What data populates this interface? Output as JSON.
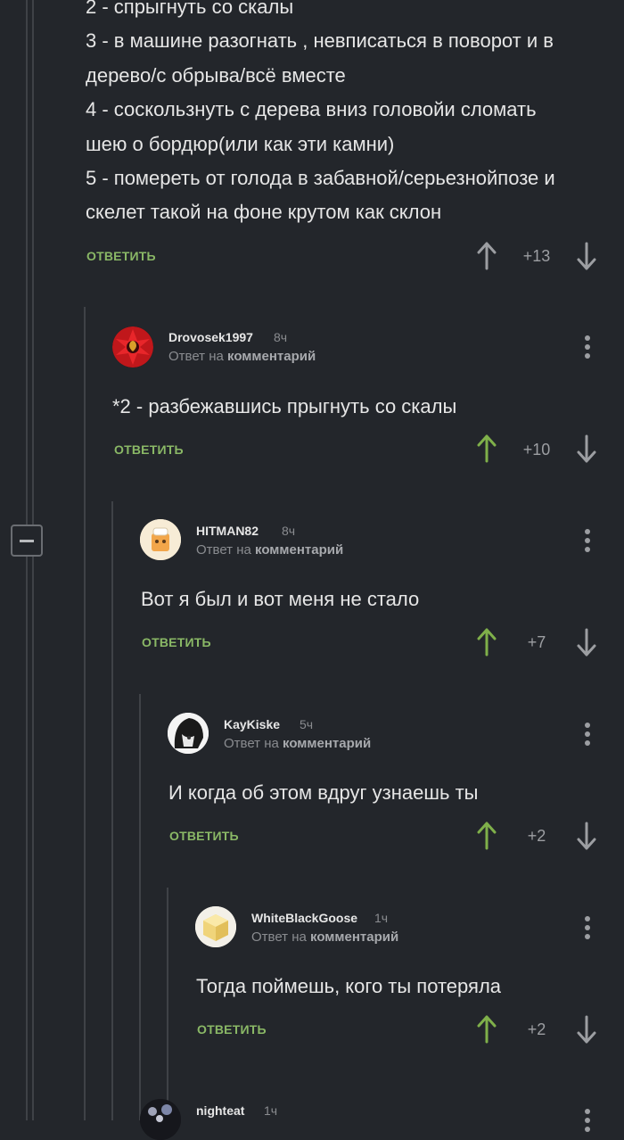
{
  "top_comment": {
    "lines": [
      "2 - спрыгнуть со скалы",
      "3 - в машине разогнать , невписаться в поворот и в",
      "дерево/с обрыва/всё вместе",
      "4 - соскользнуть с дерева вниз головойи сломать",
      "шею о бордюр(или как эти камни)",
      "5 - помереть от голода в забавной/серьезнойпозе и",
      "скелет такой на фоне крутом как склон"
    ],
    "reply_label": "ОТВЕТИТЬ",
    "score": "+13"
  },
  "comments": [
    {
      "author": "Drovosek1997",
      "time": "8ч",
      "reply_to_prefix": "Ответ на",
      "reply_to_target": "комментарий",
      "text": "*2 - разбежавшись прыгнуть со скалы",
      "reply_label": "ОТВЕТИТЬ",
      "score": "+10",
      "upvoted": true
    },
    {
      "author": "HITMAN82",
      "time": "8ч",
      "reply_to_prefix": "Ответ на",
      "reply_to_target": "комментарий",
      "text": "Вот я был и вот меня не стало",
      "reply_label": "ОТВЕТИТЬ",
      "score": "+7",
      "upvoted": true
    },
    {
      "author": "KayKiske",
      "time": "5ч",
      "reply_to_prefix": "Ответ на",
      "reply_to_target": "комментарий",
      "text": "И когда об этом вдруг узнаешь ты",
      "reply_label": "ОТВЕТИТЬ",
      "score": "+2",
      "upvoted": true
    },
    {
      "author": "WhiteBlackGoose",
      "time": "1ч",
      "reply_to_prefix": "Ответ на",
      "reply_to_target": "комментарий",
      "text": "Тогда поймешь, кого ты потеряла",
      "reply_label": "ОТВЕТИТЬ",
      "score": "+2",
      "upvoted": true
    },
    {
      "author": "nighteat",
      "time": "1ч"
    }
  ],
  "colors": {
    "background": "#23262b",
    "reply_green": "#8ab866",
    "upvote_green": "#7fb04a",
    "neutral_arrow": "#9c9ea2",
    "thread_line": "#3f4247"
  },
  "icons": [
    "upvote-arrow-icon",
    "downvote-arrow-icon",
    "more-dots-icon",
    "collapse-minus-icon"
  ]
}
